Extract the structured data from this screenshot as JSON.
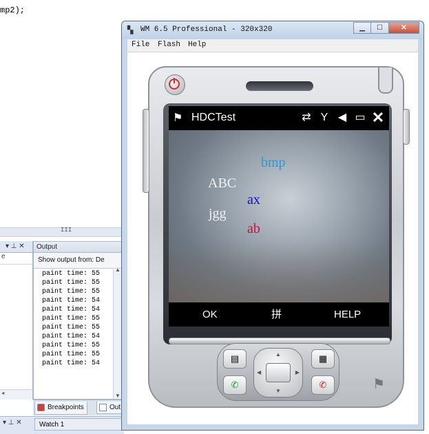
{
  "editor": {
    "code_fragment": "mp2);"
  },
  "left_panel": {
    "header_glyphs": "▾ ⊥ ✕",
    "row_label": "e",
    "splitter_grip": "III"
  },
  "output": {
    "title": "Output",
    "show_from_label": "Show output from: De",
    "lines": [
      "paint time: 55",
      "paint time: 55",
      "paint time: 55",
      "paint time: 54",
      "paint time: 54",
      "paint time: 55",
      "paint time: 55",
      "paint time: 54",
      "paint time: 55",
      "paint time: 55",
      "paint time: 54"
    ]
  },
  "bottom_tabs": {
    "breakpoints": "Breakpoints",
    "output_short": "Out"
  },
  "bottom_bar": {
    "watch": "Watch 1",
    "controls": "▾ ⊥ ✕"
  },
  "emulator": {
    "title": "WM 6.5 Professional - 320x320",
    "menu": {
      "file": "File",
      "flash": "Flash",
      "help": "Help"
    }
  },
  "device": {
    "app_title": "HDCTest",
    "status_icons": [
      "connectivity-icon",
      "signal-off-icon",
      "volume-mute-icon",
      "battery-icon"
    ],
    "paint_text": {
      "bmp": "bmp",
      "abc": "ABC",
      "ax": "ax",
      "jgg": "jgg",
      "ab": "ab"
    },
    "colors": {
      "bmp": "#2a9ad8",
      "abc": "#f2f2f2",
      "ax": "#1010c8",
      "jgg": "#f2f2f2",
      "ab": "#c8103c"
    },
    "softkeys": {
      "left": "OK",
      "middle": "拼",
      "right": "HELP"
    }
  }
}
